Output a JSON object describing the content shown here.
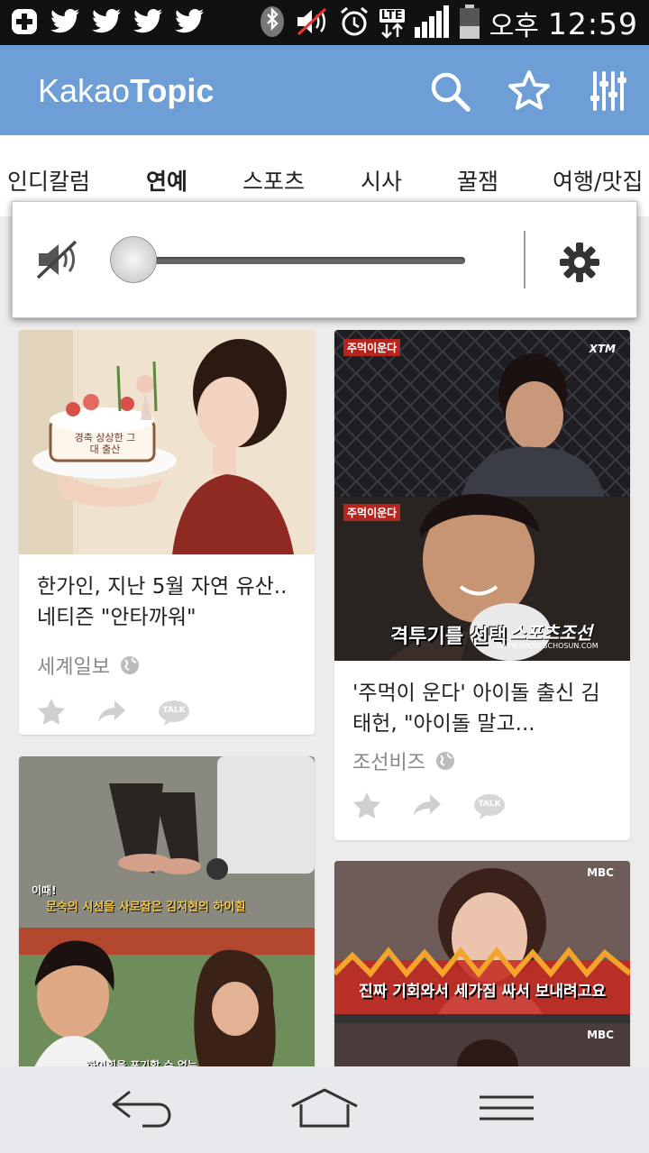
{
  "status_bar": {
    "left_icons": [
      "plus-notification-icon",
      "twitter-icon",
      "twitter-icon",
      "twitter-icon",
      "twitter-icon"
    ],
    "right_icons": [
      "bluetooth-icon",
      "muted-speaker-icon",
      "alarm-icon",
      "lte-icon",
      "signal-icon",
      "battery-icon"
    ],
    "lte_label": "LTE",
    "carrier_label": "오후",
    "time": "12:59"
  },
  "app_bar": {
    "brand_part1": "Kakao",
    "brand_part2": "Topic",
    "icons": [
      "search-icon",
      "star-icon",
      "equalizer-icon"
    ],
    "color": "#6d9fd6"
  },
  "tabs": [
    {
      "label": "인디칼럼",
      "active": false
    },
    {
      "label": "연예",
      "active": true
    },
    {
      "label": "스포츠",
      "active": false
    },
    {
      "label": "시사",
      "active": false
    },
    {
      "label": "꿀잼",
      "active": false
    },
    {
      "label": "여행/맛집",
      "active": false
    }
  ],
  "volume_panel": {
    "level": 0,
    "icons": [
      "speaker-muted-icon",
      "settings-gear-icon"
    ]
  },
  "cards": [
    {
      "image_caption": "",
      "cake_text": "경축 상상한 그대 출산",
      "title": "한가인, 지난 5월 자연 유산..네티즌 \"안타까워\"",
      "source": "세계일보"
    },
    {
      "image_captions": [
        "주먹이운다",
        "XTM",
        "격투기를 선택",
        "스포츠조선",
        "WWW.SPORTSCHOSUN.COM"
      ],
      "title": "'주먹이 운다' 아이돌 출신 김태헌, \"아이돌 말고...",
      "source": "조선비즈"
    },
    {
      "image_captions": [
        "이때!",
        "문숙의 시선을 사로잡은 김지현의 하이힐",
        "하이힐을 포기할 수 없는"
      ],
      "title": "",
      "source": ""
    },
    {
      "image_captions": [
        "MBC",
        "진짜 기회와서 세가짐 싸서 보내려고요",
        "MBC"
      ],
      "title": "",
      "source": ""
    }
  ],
  "action_labels": {
    "talk": "TALK"
  },
  "nav_bar": {
    "icons": [
      "back-icon",
      "home-icon",
      "menu-icon"
    ]
  }
}
